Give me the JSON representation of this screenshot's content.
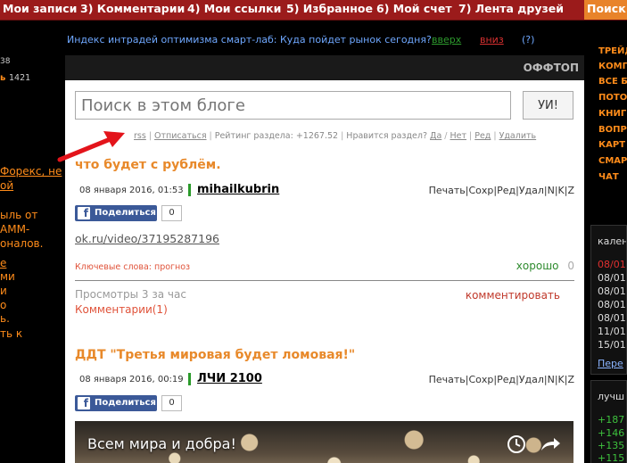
{
  "nav": {
    "items": [
      "Мои записи",
      "3) Комментарии",
      "4) Мои ссылки",
      "5) Избранное",
      "6) Мой счет",
      "7) Лента друзей"
    ],
    "search_tab": "Поиск"
  },
  "ticker": {
    "headline": "Индекс интрадей оптимизма смарт-лаб: Куда пойдет рынок сегодня?",
    "up": "вверх",
    "down": "вниз",
    "help": "(?)"
  },
  "left_col": {
    "line1": "38",
    "line2_label": "ь",
    "line2_value": "1421",
    "lines": [
      "Форекс, не",
      "ой",
      "ыль от",
      "АММ-",
      "оналов.",
      "е",
      "ми",
      "и",
      "о",
      "ь.",
      "ть к"
    ]
  },
  "blog": {
    "section": "ОФФТОП",
    "search_placeholder": "Поиск в этом блоге",
    "search_button": "УИ!",
    "tools": {
      "rss": "rss",
      "unsubscribe": "Отписаться",
      "rating": "Рейтинг раздела: +1267.52",
      "like_question": "Нравится раздел?",
      "yes": "Да",
      "no": "Нет",
      "edit": "Ред",
      "delete": "Удалить"
    }
  },
  "post_actions": "Печать|Сохр|Ред|Удал|N|K|Z",
  "posts": [
    {
      "title": "что будет с рублём.",
      "date": "08 января 2016, 01:53",
      "author": "mihailkubrin",
      "share_label": "Поделиться",
      "share_count": "0",
      "link": "ok.ru/video/37195287196",
      "keywords": "Ключевые слова: прогноз",
      "rating_label": "хорошо",
      "rating_value": "0",
      "views": "Просмотры 3 за час",
      "comments": "Комментарии(1)",
      "comment_action": "комментировать"
    },
    {
      "title": "ДДТ \"Третья мировая будет ломовая!\"",
      "date": "08 января 2016, 00:19",
      "author": "ЛЧИ 2100",
      "share_label": "Поделиться",
      "share_count": "0",
      "video_title": "Всем мира и добра!"
    }
  ],
  "right_col": {
    "menu": [
      "ТРЕЙД",
      "КОМП",
      "ВСЕ Б",
      "ПОТО",
      "КНИГ",
      "ВОПР",
      "КАРТ",
      "СМАР",
      "ЧАТ"
    ],
    "calendar_head": "кален",
    "calendar_lines": [
      "08/01",
      "08/01",
      "08/01",
      "08/01",
      "08/01",
      "11/01",
      "15/01"
    ],
    "calendar_more": "Пере",
    "best_head": "лучш",
    "best_lines": [
      "+187",
      "+146",
      "+135",
      "+115"
    ]
  },
  "colors": {
    "nav_bg": "#9b1b1b",
    "accent_orange": "#e8892a",
    "ticker_blue": "#6fa8ff",
    "up_green": "#2e9c2e",
    "down_red": "#d93030",
    "comment_red": "#e0533a",
    "fb_blue": "#3b5998"
  }
}
